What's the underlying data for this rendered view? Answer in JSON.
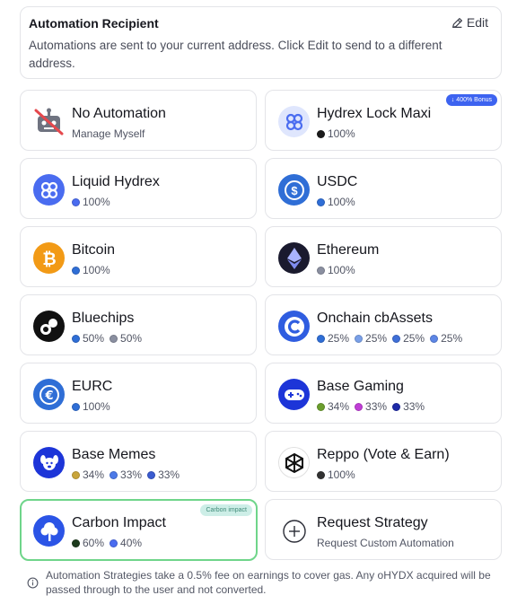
{
  "recipient": {
    "title": "Automation Recipient",
    "edit_label": "Edit",
    "description": "Automations are sent to your current address. Click Edit to send to a different address."
  },
  "strategies": [
    {
      "name": "No Automation",
      "subtitle": "Manage Myself",
      "icon": "robot-disabled-icon"
    },
    {
      "name": "Hydrex Lock Maxi",
      "badge": "400% Bonus",
      "icon": "hydrex-lock-icon",
      "allocations": [
        {
          "token": "hydrex-lock",
          "percent": "100%",
          "color": "#1b1b1b"
        }
      ]
    },
    {
      "name": "Liquid Hydrex",
      "icon": "hydrex-icon",
      "allocations": [
        {
          "token": "hydrex",
          "percent": "100%",
          "color": "#4a6cf0"
        }
      ]
    },
    {
      "name": "USDC",
      "icon": "usdc-icon",
      "allocations": [
        {
          "token": "usdc",
          "percent": "100%",
          "color": "#2f6ed6"
        }
      ]
    },
    {
      "name": "Bitcoin",
      "icon": "bitcoin-icon",
      "allocations": [
        {
          "token": "cbbtc",
          "percent": "100%",
          "color": "#2f6ed6"
        }
      ]
    },
    {
      "name": "Ethereum",
      "icon": "ethereum-icon",
      "allocations": [
        {
          "token": "eth",
          "percent": "100%",
          "color": "#8a8fa0"
        }
      ]
    },
    {
      "name": "Bluechips",
      "icon": "bluechips-icon",
      "allocations": [
        {
          "token": "cbbtc",
          "percent": "50%",
          "color": "#2f6ed6"
        },
        {
          "token": "eth",
          "percent": "50%",
          "color": "#8a8fa0"
        }
      ]
    },
    {
      "name": "Onchain cbAssets",
      "icon": "coinbase-icon",
      "allocations": [
        {
          "token": "cbxrp",
          "percent": "25%",
          "color": "#2f6ed6"
        },
        {
          "token": "cbdoge",
          "percent": "25%",
          "color": "#7aa0e8"
        },
        {
          "token": "cbltc",
          "percent": "25%",
          "color": "#3f6fd8"
        },
        {
          "token": "cbada",
          "percent": "25%",
          "color": "#5d86e6"
        }
      ]
    },
    {
      "name": "EURC",
      "icon": "eurc-icon",
      "allocations": [
        {
          "token": "eurc",
          "percent": "100%",
          "color": "#2f6ed6"
        }
      ]
    },
    {
      "name": "Base Gaming",
      "icon": "gamepad-icon",
      "allocations": [
        {
          "token": "gaming-a",
          "percent": "34%",
          "color": "#6b9e2e"
        },
        {
          "token": "gaming-b",
          "percent": "33%",
          "color": "#c03ed6"
        },
        {
          "token": "gaming-c",
          "percent": "33%",
          "color": "#1e2aa8"
        }
      ]
    },
    {
      "name": "Base Memes",
      "icon": "dog-icon",
      "allocations": [
        {
          "token": "meme-a",
          "percent": "34%",
          "color": "#c9a53a"
        },
        {
          "token": "meme-b",
          "percent": "33%",
          "color": "#4c7ae8"
        },
        {
          "token": "meme-c",
          "percent": "33%",
          "color": "#3a5bd0"
        }
      ]
    },
    {
      "name": "Reppo (Vote & Earn)",
      "icon": "reppo-icon",
      "allocations": [
        {
          "token": "reppo",
          "percent": "100%",
          "color": "#333333"
        }
      ]
    },
    {
      "name": "Carbon Impact",
      "badge": "Carbon impact",
      "selected": true,
      "icon": "tree-icon",
      "allocations": [
        {
          "token": "carbon-a",
          "percent": "60%",
          "color": "#1d3b1d"
        },
        {
          "token": "carbon-b",
          "percent": "40%",
          "color": "#4a6cf0"
        }
      ]
    },
    {
      "name": "Request Strategy",
      "subtitle": "Request Custom Automation",
      "icon": "plus-circle-icon"
    }
  ],
  "footer": {
    "note": "Automation Strategies take a 0.5% fee on earnings to cover gas. Any oHYDX acquired will be passed through to the user and not converted."
  },
  "colors": {
    "accent": "#3d63f0",
    "selected_border": "#6fd58a",
    "carbon_badge": "#cdeee7"
  }
}
